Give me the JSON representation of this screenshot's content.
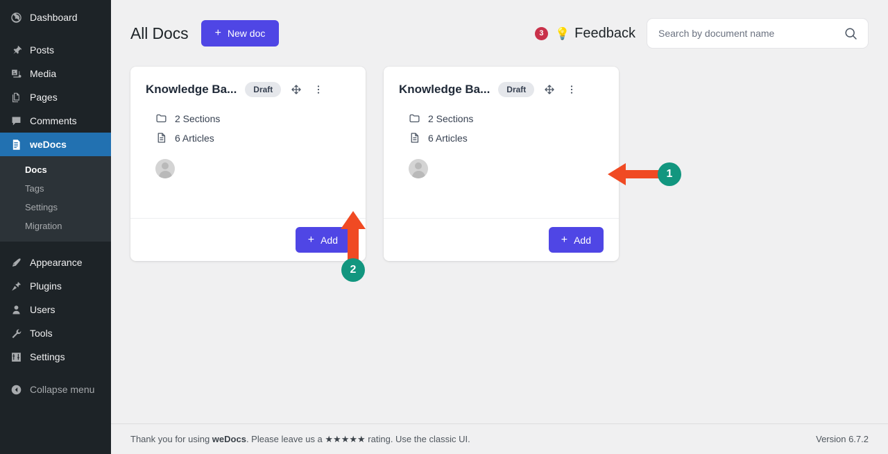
{
  "sidebar": {
    "items": [
      {
        "label": "Dashboard",
        "icon": "dashboard-icon"
      },
      {
        "label": "Posts",
        "icon": "pin-icon"
      },
      {
        "label": "Media",
        "icon": "media-icon"
      },
      {
        "label": "Pages",
        "icon": "pages-icon"
      },
      {
        "label": "Comments",
        "icon": "comments-icon"
      },
      {
        "label": "weDocs",
        "icon": "wedocs-icon",
        "active": true
      }
    ],
    "submenu": [
      {
        "label": "Docs",
        "current": true
      },
      {
        "label": "Tags"
      },
      {
        "label": "Settings"
      },
      {
        "label": "Migration"
      }
    ],
    "items_lower": [
      {
        "label": "Appearance",
        "icon": "appearance-icon"
      },
      {
        "label": "Plugins",
        "icon": "plugins-icon"
      },
      {
        "label": "Users",
        "icon": "users-icon"
      },
      {
        "label": "Tools",
        "icon": "tools-icon"
      },
      {
        "label": "Settings",
        "icon": "settings-icon"
      }
    ],
    "collapse": {
      "label": "Collapse menu",
      "icon": "collapse-arrow-icon"
    }
  },
  "header": {
    "title": "All Docs",
    "new_doc_label": "New doc",
    "new_doc_plus": "+",
    "feedback_badge": "3",
    "feedback_bulb": "💡",
    "feedback_label": "Feedback",
    "accent_color": "#4f46e5"
  },
  "search": {
    "value": "",
    "placeholder": "Search by document name"
  },
  "cards": [
    {
      "title": "Knowledge Ba...",
      "status": "Draft",
      "sections": "2 Sections",
      "articles": "6 Articles",
      "add_label": "Add",
      "add_plus": "+"
    },
    {
      "title": "Knowledge Ba...",
      "status": "Draft",
      "sections": "2 Sections",
      "articles": "6 Articles",
      "add_label": "Add",
      "add_plus": "+"
    }
  ],
  "footer": {
    "thanks_prefix": "Thank you for using ",
    "brand": "weDocs",
    "thanks_mid": ". Please leave us a ",
    "stars": "★★★★★",
    "thanks_suffix": " rating. Use the classic UI.",
    "version": "Version 6.7.2"
  },
  "annotations": [
    {
      "number": "1",
      "direction": "left",
      "color": "#f04a23",
      "badge_color": "#12967f"
    },
    {
      "number": "2",
      "direction": "up",
      "color": "#f04a23",
      "badge_color": "#12967f"
    }
  ]
}
